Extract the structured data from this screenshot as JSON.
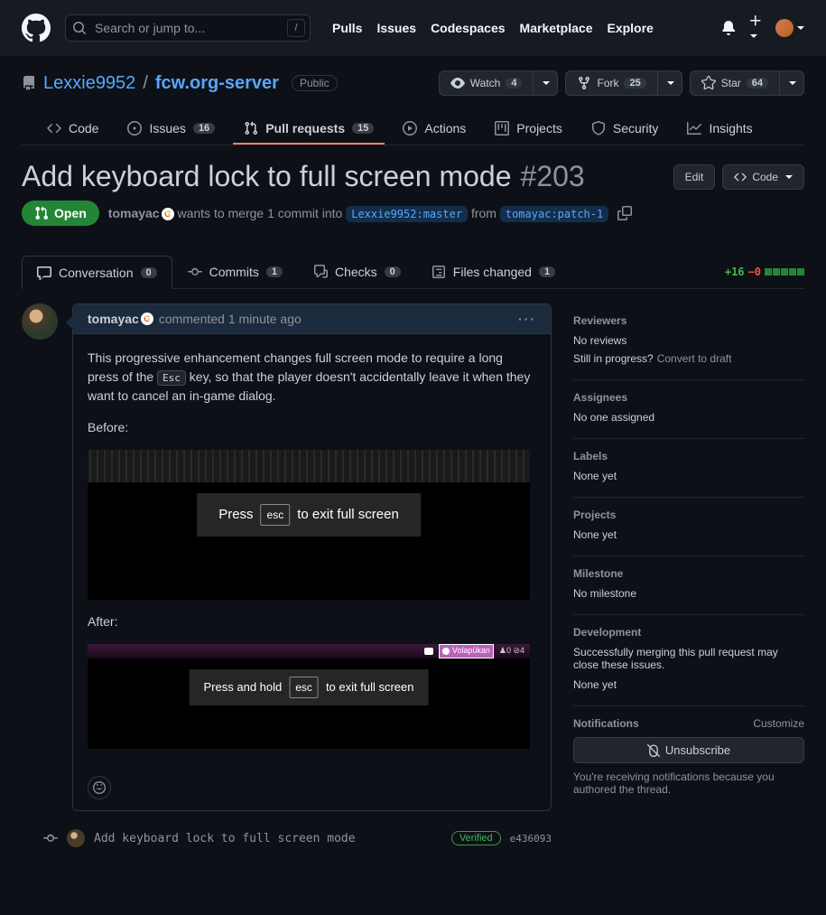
{
  "header": {
    "search_placeholder": "Search or jump to...",
    "slash": "/",
    "nav": {
      "pulls": "Pulls",
      "issues": "Issues",
      "codespaces": "Codespaces",
      "marketplace": "Marketplace",
      "explore": "Explore"
    }
  },
  "repo": {
    "owner": "Lexxie9952",
    "sep": "/",
    "name": "fcw.org-server",
    "visibility": "Public",
    "watch": {
      "label": "Watch",
      "count": "4"
    },
    "fork": {
      "label": "Fork",
      "count": "25"
    },
    "star": {
      "label": "Star",
      "count": "64"
    }
  },
  "repo_tabs": {
    "code": "Code",
    "issues": {
      "label": "Issues",
      "count": "16"
    },
    "pulls": {
      "label": "Pull requests",
      "count": "15"
    },
    "actions": "Actions",
    "projects": "Projects",
    "security": "Security",
    "insights": "Insights"
  },
  "pr": {
    "title": "Add keyboard lock to full screen mode",
    "number": "#203",
    "edit": "Edit",
    "code_btn": "Code",
    "state": "Open",
    "author": "tomayac",
    "merge_text_1": "wants to merge 1 commit into",
    "base_branch": "Lexxie9952:master",
    "merge_text_2": "from",
    "head_branch": "tomayac:patch-1"
  },
  "pr_tabs": {
    "conversation": {
      "label": "Conversation",
      "count": "0"
    },
    "commits": {
      "label": "Commits",
      "count": "1"
    },
    "checks": {
      "label": "Checks",
      "count": "0"
    },
    "files": {
      "label": "Files changed",
      "count": "1"
    },
    "diff": {
      "add": "+16",
      "del": "−0"
    }
  },
  "comment": {
    "author": "tomayac",
    "time": "commented 1 minute ago",
    "body_1a": "This progressive enhancement changes full screen mode to require a long press of the ",
    "body_1_kbd": "Esc",
    "body_1b": " key, so that the player doesn't accidentally leave it when they want to cancel an in-game dialog.",
    "before": "Before:",
    "after": "After:",
    "ss1": {
      "press": "Press",
      "esc": "esc",
      "rest": "to exit full screen"
    },
    "ss2": {
      "press": "Press and hold",
      "esc": "esc",
      "rest": "to exit full screen",
      "nation": "Volapükan",
      "stats": "♟0  ⊘4"
    }
  },
  "commit": {
    "msg": "Add keyboard lock to full screen mode",
    "verified": "Verified",
    "sha": "e436093"
  },
  "sidebar": {
    "reviewers": {
      "title": "Reviewers",
      "none": "No reviews",
      "progress": "Still in progress?",
      "convert": "Convert to draft"
    },
    "assignees": {
      "title": "Assignees",
      "none": "No one assigned"
    },
    "labels": {
      "title": "Labels",
      "none": "None yet"
    },
    "projects": {
      "title": "Projects",
      "none": "None yet"
    },
    "milestone": {
      "title": "Milestone",
      "none": "No milestone"
    },
    "development": {
      "title": "Development",
      "desc": "Successfully merging this pull request may close these issues.",
      "none": "None yet"
    },
    "notifications": {
      "title": "Notifications",
      "customize": "Customize",
      "unsub": "Unsubscribe",
      "desc": "You're receiving notifications because you authored the thread."
    }
  }
}
